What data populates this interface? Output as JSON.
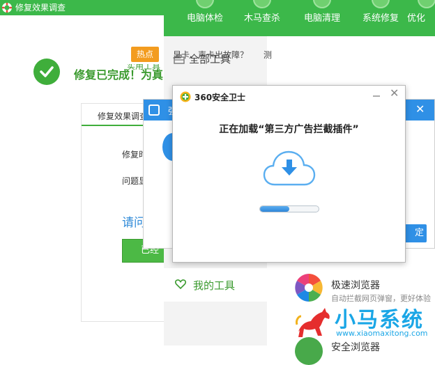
{
  "survey_window": {
    "title": "修复效果调查",
    "done_message": "修复已完成！为真",
    "tab": "修复效果调查",
    "repair_time_label": "修复时",
    "problem_label": "问题显",
    "question": "请问",
    "submit_button": "已经"
  },
  "toolbox": {
    "nav": [
      {
        "label": "电脑体检"
      },
      {
        "label": "木马查杀"
      },
      {
        "label": "电脑清理"
      },
      {
        "label": "系统修复"
      },
      {
        "label": "优化"
      }
    ],
    "sidebar": {
      "all_tools": "全部工具",
      "my_tools": "我的工具"
    },
    "hot_badge": "热点",
    "hot_text": "显卡、声卡出故障？",
    "hot_text_2": "测",
    "section_heading": "实用工具",
    "browser_name": "极速浏览器",
    "browser_desc": "自动拦截网页弹窗，更好体验",
    "second_name": "安全浏览器"
  },
  "middle_popup": {
    "title": "强",
    "close_icon": "close-icon",
    "ok_button": "定"
  },
  "loading_dialog": {
    "title": "360安全卫士",
    "message": "正在加载“第三方广告拦截插件”",
    "progress": 0.5,
    "min_icon": "minimize-icon",
    "close_icon": "close-icon"
  },
  "watermark": {
    "name": "小马系统",
    "url": "www.xiaomaxitong.com"
  },
  "colors": {
    "green": "#3cb84a",
    "blue": "#2f90e6",
    "orange": "#f39c1f"
  }
}
